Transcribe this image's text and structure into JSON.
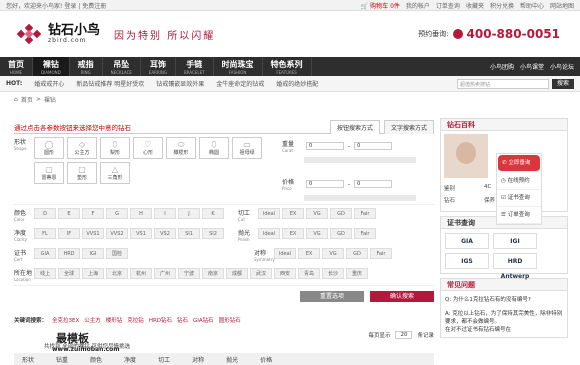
{
  "topbar": {
    "welcome": "您好，欢迎来小鸟家!",
    "login": "登录",
    "register": "免费注册",
    "cart": "购物车",
    "cart_count": "0",
    "cart_unit": "件",
    "my_account": "我的帐户",
    "order_query": "订单查询",
    "favorites": "收藏夹",
    "points": "积分兑换",
    "help": "帮助中心",
    "site_nav": "网站地图"
  },
  "header": {
    "logo_cn": "钻石小鸟",
    "logo_en": "zbird.com",
    "slogan": "因为特别  所以闪耀",
    "phone_label": "预约垂询:",
    "phone": "400-880-0051"
  },
  "nav": {
    "items": [
      {
        "cn": "首页",
        "en": "HOME"
      },
      {
        "cn": "裸钻",
        "en": "DIAMOND"
      },
      {
        "cn": "戒指",
        "en": "RING"
      },
      {
        "cn": "吊坠",
        "en": "NECKLACE"
      },
      {
        "cn": "耳饰",
        "en": "EARRING"
      },
      {
        "cn": "手链",
        "en": "BRACELET"
      },
      {
        "cn": "时尚珠宝",
        "en": "FASHION"
      },
      {
        "cn": "特色系列",
        "en": "FEATURES"
      }
    ],
    "right": [
      "小鸟团购",
      "小鸟课堂",
      "小鸟论坛"
    ]
  },
  "hotbar": {
    "hot": "HOT:",
    "items": [
      "婚戒戒开心",
      "新品钻戒推荐 明星好受欢",
      "钻戒镶嵌显效外果",
      "金牛座命定的钻戒",
      "婚戒的绝妙搭配"
    ],
    "search_placeholder": "超值热卖搜钻",
    "search_btn": "搜索"
  },
  "crumb": {
    "home": "首页",
    "sep": ">",
    "current": "裸钻"
  },
  "search_panel": {
    "title": "通过点击各参数按钮来选择您中意的钻石",
    "tab1": "按钮搜索方式",
    "tab2": "文字搜索方式",
    "shape": {
      "label": "形状",
      "en": "Shape",
      "items": [
        "圆形",
        "公主方",
        "梨形",
        "心形",
        "橄榄形",
        "椭圆",
        "祖母绿",
        "雷蒂恩",
        "垫形",
        "三角形"
      ]
    },
    "weight": {
      "label": "重量",
      "en": "Carat",
      "from": "0",
      "to": "0"
    },
    "price": {
      "label": "价格",
      "en": "Price",
      "from": "0",
      "to": "0"
    },
    "color": {
      "label": "颜色",
      "en": "Color",
      "items": [
        "D",
        "E",
        "F",
        "G",
        "H",
        "I",
        "J",
        "K"
      ]
    },
    "cut": {
      "label": "切工",
      "en": "Cut",
      "items": [
        "Ideal",
        "EX",
        "VG",
        "GD",
        "Fair"
      ]
    },
    "clarity": {
      "label": "净度",
      "en": "Clarity",
      "items": [
        "FL",
        "IF",
        "VVS1",
        "VVS2",
        "VS1",
        "VS2",
        "SI1",
        "SI2"
      ]
    },
    "polish": {
      "label": "抛光",
      "en": "Polish",
      "items": [
        "Ideal",
        "EX",
        "VG",
        "GD",
        "Fair"
      ]
    },
    "cert": {
      "label": "证书",
      "en": "Cert",
      "items": [
        "GIA",
        "HRD",
        "IGI",
        "国检"
      ]
    },
    "symmetry": {
      "label": "对称",
      "en": "Symmetry",
      "items": [
        "Ideal",
        "EX",
        "VG",
        "GD",
        "Fair"
      ]
    },
    "location": {
      "label": "所在地",
      "en": "Location",
      "items": [
        "线上",
        "全球",
        "上海",
        "北京",
        "杭州",
        "广州",
        "宁波",
        "南京",
        "成都",
        "武汉",
        "西安",
        "青岛",
        "长沙",
        "重庆"
      ]
    },
    "reset_btn": "重置选项",
    "confirm_btn": "确认搜索"
  },
  "keywords": {
    "label": "关键词搜索：",
    "items": [
      "全克拉3EX",
      "公主方",
      "楼形钻",
      "克拉钻",
      "HRD钻石",
      "钻石",
      "GIA钻石",
      "圆形钻石"
    ]
  },
  "sort": {
    "per_page": "每页显示",
    "count": "20",
    "unit": "条记录"
  },
  "thead": [
    "形状",
    "钻重",
    "颜色",
    "净度",
    "切工",
    "对称",
    "抛光",
    "价格"
  ],
  "notice": "共找到 全部的裸钻,可供您尽情挑选",
  "side": {
    "baike_title": "钻石百科",
    "baike_items": [
      "鉴别",
      "4C",
      "产地",
      "钻石",
      "保养",
      "证书"
    ],
    "float_items": [
      "立即垂询",
      "在线预约",
      "证书查询",
      "订单查询"
    ],
    "cert_title": "证书查询",
    "certs": [
      "GIA",
      "IGI",
      "IGS",
      "HRD Antwerp"
    ],
    "qa_title": "常见问题",
    "q": "Q: 为什么1克拉钻石有的没有编号?",
    "a": "A: 克拉以上钻石，为了保持其完美性，除非特别要求，都不会做编号。",
    "a2": "在对不过证书有钻石编号在"
  },
  "watermark": {
    "title": "最模板",
    "url": "www.zuimoban.com"
  },
  "colors": {
    "brand": "#b4183a",
    "nav": "#2e2e2e"
  }
}
